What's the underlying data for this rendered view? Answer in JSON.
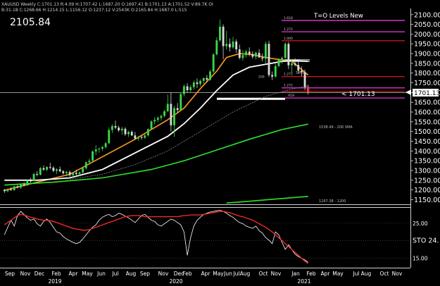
{
  "header": {
    "symbol_line": "XAUUSD Weekly  C:1701.13  R:4.09  H:1707.42  L:1687.20  O:1697.41  B:1701.13  A:1701.52  V:89.7K  OI",
    "indicator_line": "B:31-18  C:1268.66  H:1214.15  L:1156.12  O:1237.12  V:2543K  O:2165.84  H:1687.0  L:515",
    "big_price": "2105.84"
  },
  "colors": {
    "background": "#000000",
    "bull": "#39d84a",
    "bear": "#d8d8d8",
    "ema_orange": "#ff9a1f",
    "sma_white": "#ffffff",
    "sma_dashed": "#8a8a8a",
    "sma200": "#2fe02f",
    "sma1200": "#2fe02f",
    "fib_magenta": "#e63bd8",
    "red_level": "#c01818",
    "oscillator_k": "#ff2a2a",
    "oscillator_d": "#ffffff"
  },
  "chart_data": [
    {
      "type": "candlestick",
      "title": "T=O Levels New",
      "ylim": [
        1130,
        2110
      ],
      "y_ticks": [
        1150,
        1200,
        1250,
        1300,
        1350,
        1400,
        1450,
        1500,
        1550,
        1600,
        1650,
        1700,
        1750,
        1800,
        1850,
        1900,
        1950,
        2000,
        2050,
        2100
      ],
      "x_month_labels": [
        "Sep",
        "Nov",
        "Dec",
        "Feb",
        "Apr",
        "May",
        "Jun",
        "Jul",
        "Aug",
        "Sep",
        "Nov",
        "Dec",
        "Feb",
        "Apr",
        "May",
        "Jun",
        "Jul",
        "Aug",
        "Oct",
        "Nov",
        "Jan",
        "Feb",
        "Apr",
        "May",
        "Jul",
        "Aug",
        "Oct",
        "Nov"
      ],
      "x_year_labels": [
        "2019",
        "2020",
        "2021"
      ],
      "candles": [
        [
          1200,
          1205,
          1185,
          1194
        ],
        [
          1194,
          1208,
          1188,
          1203
        ],
        [
          1203,
          1214,
          1196,
          1199
        ],
        [
          1199,
          1222,
          1196,
          1218
        ],
        [
          1218,
          1226,
          1208,
          1212
        ],
        [
          1212,
          1232,
          1206,
          1228
        ],
        [
          1228,
          1240,
          1218,
          1224
        ],
        [
          1224,
          1252,
          1220,
          1248
        ],
        [
          1248,
          1262,
          1238,
          1246
        ],
        [
          1246,
          1288,
          1242,
          1282
        ],
        [
          1282,
          1296,
          1270,
          1278
        ],
        [
          1278,
          1318,
          1274,
          1312
        ],
        [
          1312,
          1326,
          1298,
          1304
        ],
        [
          1304,
          1322,
          1296,
          1318
        ],
        [
          1318,
          1340,
          1306,
          1314
        ],
        [
          1314,
          1322,
          1292,
          1298
        ],
        [
          1298,
          1312,
          1282,
          1306
        ],
        [
          1306,
          1320,
          1290,
          1296
        ],
        [
          1296,
          1302,
          1278,
          1286
        ],
        [
          1286,
          1298,
          1270,
          1292
        ],
        [
          1292,
          1300,
          1268,
          1276
        ],
        [
          1276,
          1292,
          1266,
          1288
        ],
        [
          1288,
          1304,
          1276,
          1282
        ],
        [
          1282,
          1296,
          1270,
          1290
        ],
        [
          1290,
          1316,
          1284,
          1312
        ],
        [
          1312,
          1348,
          1304,
          1342
        ],
        [
          1342,
          1362,
          1330,
          1350
        ],
        [
          1350,
          1402,
          1344,
          1398
        ],
        [
          1398,
          1430,
          1380,
          1408
        ],
        [
          1408,
          1418,
          1390,
          1412
        ],
        [
          1412,
          1426,
          1400,
          1420
        ],
        [
          1420,
          1446,
          1412,
          1440
        ],
        [
          1440,
          1522,
          1436,
          1508
        ],
        [
          1508,
          1536,
          1492,
          1528
        ],
        [
          1528,
          1556,
          1512,
          1520
        ],
        [
          1520,
          1530,
          1498,
          1506
        ],
        [
          1506,
          1524,
          1484,
          1514
        ],
        [
          1514,
          1522,
          1478,
          1486
        ],
        [
          1486,
          1504,
          1472,
          1498
        ],
        [
          1498,
          1506,
          1476,
          1480
        ],
        [
          1480,
          1498,
          1458,
          1464
        ],
        [
          1464,
          1478,
          1452,
          1472
        ],
        [
          1472,
          1482,
          1458,
          1468
        ],
        [
          1468,
          1488,
          1462,
          1480
        ],
        [
          1480,
          1516,
          1474,
          1512
        ],
        [
          1512,
          1558,
          1508,
          1552
        ],
        [
          1552,
          1574,
          1536,
          1560
        ],
        [
          1560,
          1578,
          1548,
          1570
        ],
        [
          1570,
          1588,
          1556,
          1580
        ],
        [
          1580,
          1612,
          1572,
          1604
        ],
        [
          1604,
          1690,
          1600,
          1642
        ],
        [
          1642,
          1702,
          1500,
          1532
        ],
        [
          1532,
          1632,
          1472,
          1620
        ],
        [
          1620,
          1646,
          1596,
          1610
        ],
        [
          1610,
          1700,
          1604,
          1692
        ],
        [
          1692,
          1742,
          1680,
          1732
        ],
        [
          1732,
          1748,
          1700,
          1712
        ],
        [
          1712,
          1738,
          1702,
          1728
        ],
        [
          1728,
          1762,
          1716,
          1752
        ],
        [
          1752,
          1772,
          1724,
          1744
        ],
        [
          1744,
          1768,
          1732,
          1760
        ],
        [
          1760,
          1778,
          1744,
          1774
        ],
        [
          1774,
          1790,
          1752,
          1766
        ],
        [
          1766,
          1818,
          1760,
          1808
        ],
        [
          1808,
          1902,
          1800,
          1896
        ],
        [
          1896,
          1984,
          1890,
          1968
        ],
        [
          1968,
          2075,
          1960,
          2038
        ],
        [
          2038,
          2050,
          1870,
          1938
        ],
        [
          1938,
          2016,
          1920,
          1950
        ],
        [
          1950,
          1978,
          1910,
          1932
        ],
        [
          1932,
          1986,
          1924,
          1962
        ],
        [
          1962,
          1974,
          1904,
          1922
        ],
        [
          1922,
          1946,
          1870,
          1878
        ],
        [
          1878,
          1918,
          1864,
          1892
        ],
        [
          1892,
          1920,
          1880,
          1910
        ],
        [
          1910,
          1932,
          1886,
          1898
        ],
        [
          1898,
          1912,
          1874,
          1884
        ],
        [
          1884,
          1910,
          1870,
          1904
        ],
        [
          1904,
          1922,
          1880,
          1880
        ],
        [
          1880,
          1900,
          1860,
          1874
        ],
        [
          1874,
          1962,
          1850,
          1950
        ],
        [
          1950,
          1966,
          1780,
          1790
        ],
        [
          1790,
          1808,
          1764,
          1782
        ],
        [
          1782,
          1848,
          1776,
          1836
        ],
        [
          1836,
          1876,
          1830,
          1868
        ],
        [
          1868,
          1886,
          1848,
          1878
        ],
        [
          1878,
          1958,
          1872,
          1950
        ],
        [
          1950,
          1960,
          1820,
          1840
        ],
        [
          1840,
          1872,
          1802,
          1850
        ],
        [
          1850,
          1876,
          1834,
          1842
        ],
        [
          1842,
          1872,
          1796,
          1812
        ],
        [
          1812,
          1834,
          1784,
          1804
        ],
        [
          1804,
          1818,
          1712,
          1728
        ],
        [
          1728,
          1740,
          1690,
          1701
        ]
      ],
      "lines": [
        {
          "name": "EMA",
          "x": [
            0,
            10,
            20,
            30,
            40,
            50,
            55,
            60,
            65,
            68,
            72,
            76,
            80,
            84,
            88,
            93
          ],
          "y": [
            1198,
            1240,
            1280,
            1370,
            1460,
            1560,
            1620,
            1720,
            1810,
            1880,
            1900,
            1895,
            1880,
            1870,
            1860,
            1790
          ]
        },
        {
          "name": "SMA",
          "x": [
            0,
            10,
            20,
            30,
            40,
            50,
            55,
            60,
            65,
            70,
            75,
            80,
            85,
            88,
            93
          ],
          "y": [
            1250,
            1250,
            1262,
            1305,
            1390,
            1475,
            1540,
            1620,
            1710,
            1790,
            1830,
            1845,
            1860,
            1864,
            1860
          ]
        },
        {
          "name": "SMA slow",
          "x": [
            20,
            30,
            40,
            50,
            60,
            70,
            80,
            88,
            93
          ],
          "y": [
            1255,
            1280,
            1330,
            1400,
            1500,
            1600,
            1680,
            1718,
            1735
          ]
        },
        {
          "name": "1538.49 - 200 SMA",
          "x": [
            0,
            15,
            30,
            45,
            55,
            65,
            75,
            85,
            93
          ],
          "y": [
            1225,
            1240,
            1262,
            1305,
            1350,
            1405,
            1460,
            1510,
            1538
          ]
        },
        {
          "name": "1167.38 - 1200",
          "x": [
            68,
            75,
            82,
            88,
            93
          ],
          "y": [
            1133,
            1142,
            1152,
            1160,
            1167
          ]
        }
      ],
      "annotations": [
        {
          "label": "1538.49 - 200 SMA",
          "y": 1538.49
        },
        {
          "label": "1167.38 - 1200",
          "y": 1167.38
        },
        {
          "label": "< 1701.13",
          "y": 1701.13
        },
        {
          "label": "1701.13",
          "y": 1701.13
        }
      ],
      "levels": [
        {
          "label": "1.618",
          "y": 2070,
          "color": "magenta"
        },
        {
          "label": "1.272",
          "y": 2012,
          "color": "magenta"
        },
        {
          "label": "1.000",
          "y": 1966,
          "color": "red"
        },
        {
          "label": "",
          "y": 1868,
          "color": "white"
        },
        {
          "label": "",
          "y": 1860,
          "color": "white"
        },
        {
          "label": "1.272",
          "y": 1782,
          "color": "red"
        },
        {
          "label": "1.272",
          "y": 1724,
          "color": "magenta"
        },
        {
          "label": "",
          "y": 1706,
          "color": "red"
        },
        {
          "label": ".618",
          "y": 1672,
          "color": "magenta"
        }
      ],
      "inline_labels": [
        "200",
        "1.618"
      ]
    },
    {
      "type": "line",
      "title": "STO",
      "ylim": [
        0,
        100
      ],
      "y_ticks": [
        {
          "label": "25.00",
          "y": 75
        },
        {
          "label": "STO 24.",
          "y": 45
        },
        {
          "label": "15.00",
          "y": 15
        }
      ],
      "series": [
        {
          "name": "K",
          "values": [
            72,
            76,
            80,
            84,
            88,
            90,
            89,
            87,
            85,
            84,
            82,
            81,
            80,
            80,
            79,
            78,
            76,
            74,
            72,
            70,
            68,
            66,
            65,
            64,
            63,
            63,
            64,
            66,
            68,
            70,
            72,
            74,
            76,
            78,
            80,
            82,
            84,
            86,
            87,
            88,
            88,
            88,
            87,
            86,
            86,
            86,
            86,
            86,
            86,
            86,
            86,
            86,
            86,
            86,
            87,
            88,
            88,
            89,
            89,
            89,
            89,
            90,
            91,
            92,
            93,
            94,
            95,
            95,
            94,
            93,
            91,
            89,
            87,
            86,
            84,
            82,
            80,
            77,
            74,
            71,
            68,
            64,
            60,
            55,
            50,
            45,
            40,
            35,
            30,
            25,
            20,
            15,
            10,
            6
          ]
        },
        {
          "name": "D",
          "values": [
            55,
            68,
            80,
            70,
            88,
            95,
            90,
            84,
            80,
            82,
            74,
            70,
            78,
            82,
            76,
            68,
            60,
            58,
            52,
            48,
            45,
            42,
            40,
            42,
            48,
            55,
            62,
            68,
            72,
            80,
            85,
            88,
            90,
            86,
            88,
            92,
            90,
            87,
            84,
            80,
            76,
            82,
            88,
            90,
            85,
            80,
            78,
            72,
            70,
            74,
            78,
            82,
            80,
            76,
            72,
            60,
            20,
            50,
            70,
            80,
            85,
            90,
            92,
            94,
            95,
            96,
            97,
            95,
            92,
            88,
            85,
            80,
            76,
            74,
            70,
            68,
            66,
            70,
            62,
            58,
            50,
            46,
            40,
            60,
            55,
            42,
            30,
            38,
            30,
            22,
            18,
            15,
            12,
            8
          ]
        }
      ]
    }
  ],
  "tick_label_2021_note": "Jan Feb"
}
